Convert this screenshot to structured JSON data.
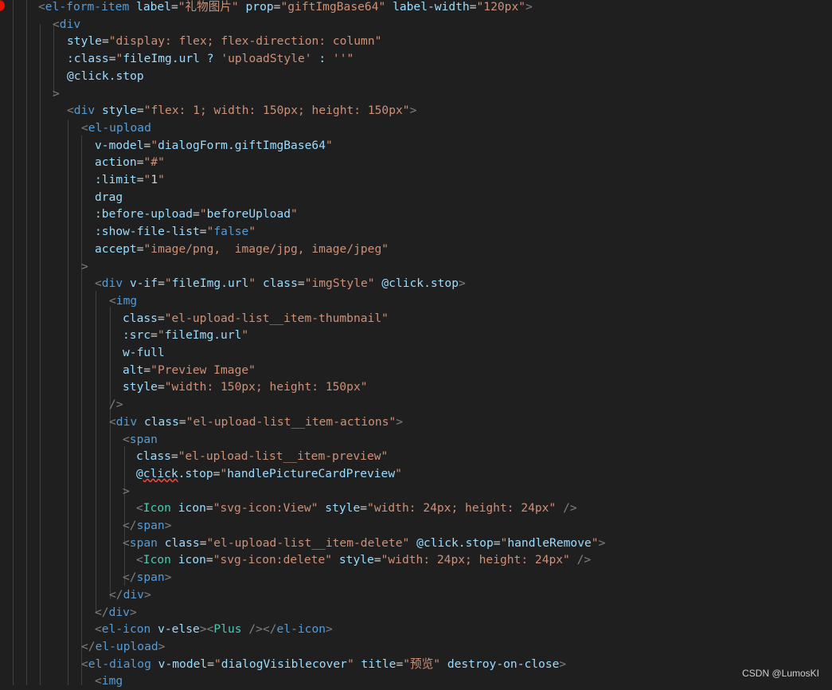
{
  "code_lines": [
    [
      [
        "p",
        "<"
      ],
      [
        "t",
        "el-form-item"
      ],
      [
        "d",
        " "
      ],
      [
        "a",
        "label"
      ],
      [
        "d",
        "="
      ],
      [
        "s",
        "\"礼物图片\""
      ],
      [
        "d",
        " "
      ],
      [
        "a",
        "prop"
      ],
      [
        "d",
        "="
      ],
      [
        "s",
        "\"giftImgBase64\""
      ],
      [
        "d",
        " "
      ],
      [
        "a",
        "label-width"
      ],
      [
        "d",
        "="
      ],
      [
        "s",
        "\"120px\""
      ],
      [
        "p",
        ">"
      ]
    ],
    [
      [
        "p",
        "<"
      ],
      [
        "t",
        "div"
      ]
    ],
    [
      [
        "a",
        "style"
      ],
      [
        "d",
        "="
      ],
      [
        "s",
        "\"display: flex; flex-direction: column\""
      ]
    ],
    [
      [
        "a",
        ":class"
      ],
      [
        "d",
        "="
      ],
      [
        "s",
        "\""
      ],
      [
        "a",
        "fileImg.url ? "
      ],
      [
        "s",
        "'uploadStyle'"
      ],
      [
        "a",
        " : "
      ],
      [
        "s",
        "''"
      ],
      [
        "s",
        "\""
      ]
    ],
    [
      [
        "a",
        "@click.stop"
      ]
    ],
    [
      [
        "p",
        ">"
      ]
    ],
    [
      [
        "p",
        "<"
      ],
      [
        "t",
        "div"
      ],
      [
        "d",
        " "
      ],
      [
        "a",
        "style"
      ],
      [
        "d",
        "="
      ],
      [
        "s",
        "\"flex: 1; width: 150px; height: 150px\""
      ],
      [
        "p",
        ">"
      ]
    ],
    [
      [
        "p",
        "<"
      ],
      [
        "t",
        "el-upload"
      ]
    ],
    [
      [
        "a",
        "v-model"
      ],
      [
        "d",
        "="
      ],
      [
        "s",
        "\""
      ],
      [
        "a",
        "dialogForm.giftImgBase64"
      ],
      [
        "s",
        "\""
      ]
    ],
    [
      [
        "a",
        "action"
      ],
      [
        "d",
        "="
      ],
      [
        "s",
        "\"#\""
      ]
    ],
    [
      [
        "a",
        ":limit"
      ],
      [
        "d",
        "="
      ],
      [
        "s",
        "\""
      ],
      [
        "d",
        "1"
      ],
      [
        "s",
        "\""
      ]
    ],
    [
      [
        "a",
        "drag"
      ]
    ],
    [
      [
        "a",
        ":before-upload"
      ],
      [
        "d",
        "="
      ],
      [
        "s",
        "\""
      ],
      [
        "a",
        "beforeUpload"
      ],
      [
        "s",
        "\""
      ]
    ],
    [
      [
        "a",
        ":show-file-list"
      ],
      [
        "d",
        "="
      ],
      [
        "s",
        "\""
      ],
      [
        "t",
        "false"
      ],
      [
        "s",
        "\""
      ]
    ],
    [
      [
        "a",
        "accept"
      ],
      [
        "d",
        "="
      ],
      [
        "s",
        "\"image/png,  image/jpg, image/jpeg\""
      ]
    ],
    [
      [
        "p",
        ">"
      ]
    ],
    [
      [
        "p",
        "<"
      ],
      [
        "t",
        "div"
      ],
      [
        "d",
        " "
      ],
      [
        "a",
        "v-if"
      ],
      [
        "d",
        "="
      ],
      [
        "s",
        "\""
      ],
      [
        "a",
        "fileImg.url"
      ],
      [
        "s",
        "\""
      ],
      [
        "d",
        " "
      ],
      [
        "a",
        "class"
      ],
      [
        "d",
        "="
      ],
      [
        "s",
        "\"imgStyle\""
      ],
      [
        "d",
        " "
      ],
      [
        "a",
        "@click.stop"
      ],
      [
        "p",
        ">"
      ]
    ],
    [
      [
        "p",
        "<"
      ],
      [
        "t",
        "img"
      ]
    ],
    [
      [
        "a",
        "class"
      ],
      [
        "d",
        "="
      ],
      [
        "s",
        "\"el-upload-list__item-thumbnail\""
      ]
    ],
    [
      [
        "a",
        ":src"
      ],
      [
        "d",
        "="
      ],
      [
        "s",
        "\""
      ],
      [
        "a",
        "fileImg.url"
      ],
      [
        "s",
        "\""
      ]
    ],
    [
      [
        "a",
        "w-full"
      ]
    ],
    [
      [
        "a",
        "alt"
      ],
      [
        "d",
        "="
      ],
      [
        "s",
        "\"Preview Image\""
      ]
    ],
    [
      [
        "a",
        "style"
      ],
      [
        "d",
        "="
      ],
      [
        "s",
        "\"width: 150px; height: 150px\""
      ]
    ],
    [
      [
        "p",
        "/>"
      ]
    ],
    [
      [
        "p",
        "<"
      ],
      [
        "t",
        "div"
      ],
      [
        "d",
        " "
      ],
      [
        "a",
        "class"
      ],
      [
        "d",
        "="
      ],
      [
        "s",
        "\"el-upload-list__item-actions\""
      ],
      [
        "p",
        ">"
      ]
    ],
    [
      [
        "p",
        "<"
      ],
      [
        "t",
        "span"
      ]
    ],
    [
      [
        "a",
        "class"
      ],
      [
        "d",
        "="
      ],
      [
        "s",
        "\"el-upload-list__item-preview\""
      ]
    ],
    [
      [
        "a",
        "@"
      ],
      [
        "sq",
        "click"
      ],
      [
        "a",
        ".stop"
      ],
      [
        "d",
        "="
      ],
      [
        "s",
        "\""
      ],
      [
        "a",
        "handlePictureCardPreview"
      ],
      [
        "s",
        "\""
      ]
    ],
    [
      [
        "p",
        ">"
      ]
    ],
    [
      [
        "p",
        "<"
      ],
      [
        "c",
        "Icon"
      ],
      [
        "d",
        " "
      ],
      [
        "a",
        "icon"
      ],
      [
        "d",
        "="
      ],
      [
        "s",
        "\"svg-icon:View\""
      ],
      [
        "d",
        " "
      ],
      [
        "a",
        "style"
      ],
      [
        "d",
        "="
      ],
      [
        "s",
        "\"width: 24px; height: 24px\""
      ],
      [
        "d",
        " "
      ],
      [
        "p",
        "/>"
      ]
    ],
    [
      [
        "p",
        "</"
      ],
      [
        "t",
        "span"
      ],
      [
        "p",
        ">"
      ]
    ],
    [
      [
        "p",
        "<"
      ],
      [
        "t",
        "span"
      ],
      [
        "d",
        " "
      ],
      [
        "a",
        "class"
      ],
      [
        "d",
        "="
      ],
      [
        "s",
        "\"el-upload-list__item-delete\""
      ],
      [
        "d",
        " "
      ],
      [
        "a",
        "@click.stop"
      ],
      [
        "d",
        "="
      ],
      [
        "s",
        "\""
      ],
      [
        "a",
        "handleRemove"
      ],
      [
        "s",
        "\""
      ],
      [
        "p",
        ">"
      ]
    ],
    [
      [
        "p",
        "<"
      ],
      [
        "c",
        "Icon"
      ],
      [
        "d",
        " "
      ],
      [
        "a",
        "icon"
      ],
      [
        "d",
        "="
      ],
      [
        "s",
        "\"svg-icon:delete\""
      ],
      [
        "d",
        " "
      ],
      [
        "a",
        "style"
      ],
      [
        "d",
        "="
      ],
      [
        "s",
        "\"width: 24px; height: 24px\""
      ],
      [
        "d",
        " "
      ],
      [
        "p",
        "/>"
      ]
    ],
    [
      [
        "p",
        "</"
      ],
      [
        "t",
        "span"
      ],
      [
        "p",
        ">"
      ]
    ],
    [
      [
        "p",
        "</"
      ],
      [
        "t",
        "div"
      ],
      [
        "p",
        ">"
      ]
    ],
    [
      [
        "p",
        "</"
      ],
      [
        "t",
        "div"
      ],
      [
        "p",
        ">"
      ]
    ],
    [
      [
        "p",
        "<"
      ],
      [
        "t",
        "el-icon"
      ],
      [
        "d",
        " "
      ],
      [
        "a",
        "v-else"
      ],
      [
        "p",
        ">"
      ],
      [
        "p",
        "<"
      ],
      [
        "c",
        "Plus"
      ],
      [
        "d",
        " "
      ],
      [
        "p",
        "/>"
      ],
      [
        "p",
        "</"
      ],
      [
        "t",
        "el-icon"
      ],
      [
        "p",
        ">"
      ]
    ],
    [
      [
        "p",
        "</"
      ],
      [
        "t",
        "el-upload"
      ],
      [
        "p",
        ">"
      ]
    ],
    [
      [
        "p",
        "<"
      ],
      [
        "t",
        "el-dialog"
      ],
      [
        "d",
        " "
      ],
      [
        "a",
        "v-model"
      ],
      [
        "d",
        "="
      ],
      [
        "s",
        "\""
      ],
      [
        "a",
        "dialogVisiblecover"
      ],
      [
        "s",
        "\""
      ],
      [
        "d",
        " "
      ],
      [
        "a",
        "title"
      ],
      [
        "d",
        "="
      ],
      [
        "s",
        "\"预览\""
      ],
      [
        "d",
        " "
      ],
      [
        "a",
        "destroy-on-close"
      ],
      [
        "p",
        ">"
      ]
    ],
    [
      [
        "p",
        "<"
      ],
      [
        "t",
        "img"
      ]
    ]
  ],
  "watermark": "CSDN @LumosKI"
}
